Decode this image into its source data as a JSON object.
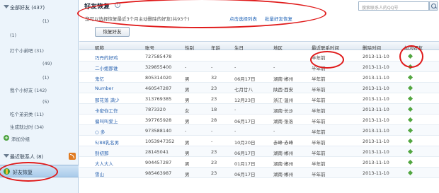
{
  "sidebar": {
    "all_friends": "全部好友 (437)",
    "items": [
      "(1)",
      "(1)",
      "打个小弟吧 (31)",
      "(49)",
      "(1)",
      "我个小好友 (142)",
      "(5)",
      "吃个弟弟类 (11)",
      "生成就过时 (34)"
    ],
    "add_group": "添加分组",
    "recent_contacts": "最近联系人 (8)",
    "friend_recovery": "好友恢复"
  },
  "header": {
    "title": "好友恢复",
    "description": "您可以选择恢复最近3个月主动删除的好友(共93个)",
    "link_select_list": "点击选择列表",
    "link_batch": "批量好友恢复",
    "recover_button": "恢复好友",
    "search_placeholder": "搜索联系人的QQ号"
  },
  "table": {
    "headers": [
      "昵称",
      "账号",
      "性别",
      "年龄",
      "生日",
      "地区",
      "最近联系时间",
      "删除时间",
      "加为好友"
    ],
    "rows": [
      [
        "巧丹的好鸡",
        "727585478",
        "",
        "",
        "",
        "",
        "半年前",
        "2013-11-10"
      ],
      [
        "二小姐那谁",
        "329855400",
        "-",
        "-",
        "-",
        "-",
        "半年前",
        "2013-11-10"
      ],
      [
        "鬼忆",
        "805314020",
        "男",
        "32",
        "06月17日",
        "湖南·郴州",
        "半年前",
        "2013-11-10"
      ],
      [
        "Number",
        "460547287",
        "男",
        "23",
        "七月廿八",
        "陕西·西安",
        "半年前",
        "2013-11-10"
      ],
      [
        "那花落 满少",
        "313769385",
        "男",
        "23",
        "12月23日",
        "浙江·温州",
        "半年前",
        "2013-11-10"
      ],
      [
        "卡密你工作",
        "7873320",
        "女",
        "18",
        "-",
        "湖南·长沙",
        "半年前",
        "2013-11-10"
      ],
      [
        "偏叫叫爱上",
        "397765928",
        "男",
        "28",
        "06月17日",
        "湖南·张洛",
        "半年前",
        "2013-11-10"
      ],
      [
        "○ 多",
        "973588140",
        "-",
        "-",
        "-",
        "-",
        "半年前",
        "2013-11-10"
      ],
      [
        "5/88乳名男",
        "1053947352",
        "男",
        "-",
        "10月20日",
        "赤峰·赤峰",
        "半年前",
        "2013-11-10"
      ],
      [
        "别初那",
        "28145041",
        "男",
        "23",
        "06月17日",
        "湖南·郴州",
        "半年前",
        "2013-11-10"
      ],
      [
        "大人大人",
        "904457287",
        "男",
        "23",
        "01月17日",
        "湖南·郴州",
        "半年前",
        "2013-11-10"
      ],
      [
        "雪山",
        "985463987",
        "男",
        "23",
        "06月17日",
        "湖南·郴州",
        "半年前",
        "2013-11-10"
      ]
    ]
  },
  "colors": {
    "annotation": "#e01b1b",
    "sidebar_bg": "#ecf4fb",
    "link": "#2466b8",
    "add_icon": "#52a640"
  }
}
